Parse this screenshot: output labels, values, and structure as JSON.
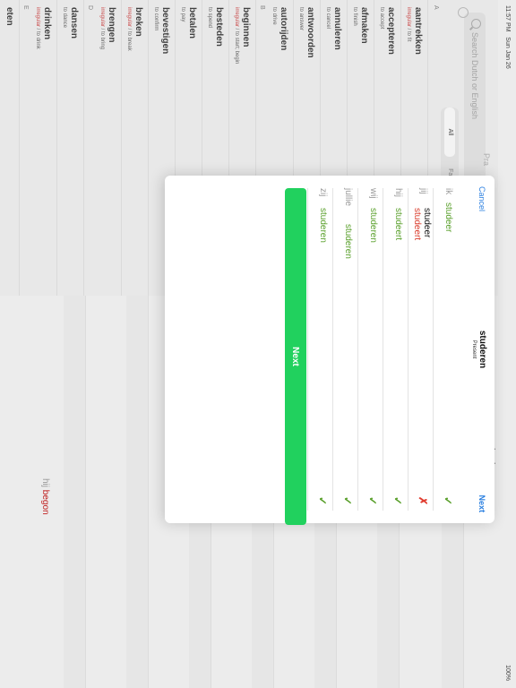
{
  "status_bar": {
    "time": "11:57 PM",
    "date": "Sun Jan 26",
    "battery": "100%"
  },
  "search": {
    "placeholder": "Search Dutch or English"
  },
  "filter": {
    "all": "All",
    "favorites": "Favorites"
  },
  "practice_label": "Pra",
  "sections": {
    "a": "A",
    "b": "B",
    "d": "D",
    "e": "E"
  },
  "verbs": [
    {
      "verb": "aantrekken",
      "irregular": "irregular",
      "translation": " / to fit"
    },
    {
      "verb": "accepteren",
      "translation": "to accept"
    },
    {
      "verb": "afmaken",
      "translation": "to finish"
    },
    {
      "verb": "annuleren",
      "translation": "to cancel"
    },
    {
      "verb": "antwoorden",
      "translation": "to answer"
    },
    {
      "verb": "autorijden",
      "translation": "to drive"
    },
    {
      "verb": "beginnen",
      "irregular": "irregular",
      "translation": " / to start; begin"
    },
    {
      "verb": "besteden",
      "translation": "to spend"
    },
    {
      "verb": "betalen",
      "translation": "to pay"
    },
    {
      "verb": "bevestigen",
      "translation": "to confirm"
    },
    {
      "verb": "breken",
      "irregular": "irregular",
      "translation": " / to break"
    },
    {
      "verb": "brengen",
      "irregular": "irregular",
      "translation": " / to bring"
    },
    {
      "verb": "dansen",
      "translation": "to dance"
    },
    {
      "verb": "drinken",
      "irregular": "irregular",
      "translation": " / to drink"
    },
    {
      "verb": "eten"
    }
  ],
  "detail": {
    "title": "beginnen",
    "pronoun": "hij",
    "form": "begon"
  },
  "quiz": {
    "cancel": "Cancel",
    "next_top": "Next",
    "verb": "studeren",
    "tense": "Present",
    "next_button": "Next",
    "rows": [
      {
        "pronoun": "ik",
        "answer": "studeer",
        "status": "correct"
      },
      {
        "pronoun": "jij",
        "answer": "studeer",
        "correction": "studeert",
        "status": "wrong"
      },
      {
        "pronoun": "hij",
        "answer": "studeert",
        "status": "correct"
      },
      {
        "pronoun": "wij",
        "answer": "studeren",
        "status": "correct"
      },
      {
        "pronoun": "jullie",
        "answer": "studeren",
        "status": "correct"
      },
      {
        "pronoun": "zij",
        "answer": "studeren",
        "status": "correct"
      }
    ]
  },
  "colors": {
    "accent": "#2a7fe0",
    "correct": "#5aa02c",
    "wrong": "#e03b2e",
    "button": "#21d15e"
  }
}
